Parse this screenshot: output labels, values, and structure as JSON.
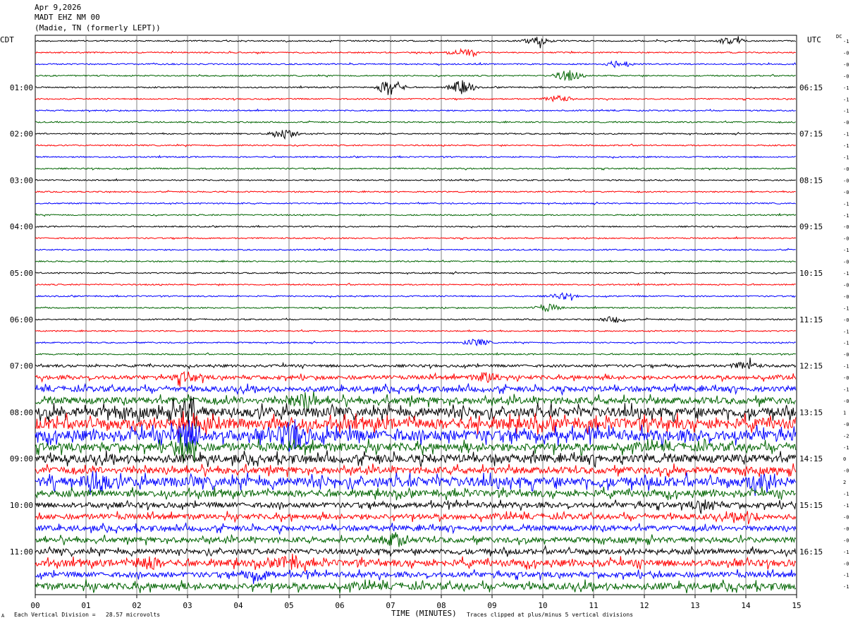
{
  "header": {
    "date": "Apr 9,2026",
    "station": "MADT EHZ NM 00",
    "location": "(Madie, TN (formerly LEPT))"
  },
  "corner_labels": {
    "left": "CDT",
    "right": "UTC",
    "dc": "DC"
  },
  "footer": {
    "scale": "Each Vertical Division =   28.57 microvolts",
    "xlabel": "TIME (MINUTES)",
    "clip_note": "Traces clipped at plus/minus 5 vertical divisions",
    "mark": "A"
  },
  "colors": {
    "black": "#000000",
    "red": "#ff0000",
    "blue": "#0000ff",
    "green": "#006400",
    "grid": "#808080"
  },
  "chart_data": {
    "type": "line",
    "title": "MADT EHZ NM 00",
    "xlabel": "TIME (MINUTES)",
    "xlim": [
      0,
      15
    ],
    "x_ticks": [
      "00",
      "01",
      "02",
      "03",
      "04",
      "05",
      "06",
      "07",
      "08",
      "09",
      "10",
      "11",
      "12",
      "13",
      "14",
      "15"
    ],
    "trace_minutes": 15,
    "left_time_labels": [
      "01:00",
      "02:00",
      "03:00",
      "04:00",
      "05:00",
      "06:00",
      "07:00",
      "08:00",
      "09:00",
      "10:00",
      "11:00"
    ],
    "right_time_labels": [
      "06:15",
      "07:15",
      "08:15",
      "09:15",
      "10:15",
      "11:15",
      "12:15",
      "13:15",
      "14:15",
      "15:15",
      "16:15"
    ],
    "dc_offsets": [
      "-1",
      "-0",
      "-0",
      "-0",
      "-1",
      "-1",
      "-1",
      "-0",
      "-1",
      "-1",
      "-1",
      "-0",
      "-0",
      "-0",
      "-1",
      "-1",
      "-0",
      "-0",
      "-1",
      "-0",
      "-1",
      "-0",
      "-0",
      "-1",
      "-0",
      "-1",
      "-1",
      "-0",
      "-1",
      "-0",
      "-1",
      "-0",
      "1",
      "-0",
      "-2",
      "-1",
      "0",
      "-0",
      "2",
      "-1",
      "-1",
      "-0",
      "-0",
      "-0",
      "-1",
      "-0",
      "-1",
      "-1"
    ],
    "trace_colors": [
      "black",
      "red",
      "blue",
      "green"
    ],
    "amplitude_per_trace": [
      1,
      1,
      1,
      1,
      1,
      1,
      1,
      1,
      1,
      1,
      1,
      1,
      1,
      1,
      1,
      1,
      1,
      1,
      1,
      1,
      1,
      1,
      1,
      1,
      1,
      1,
      1,
      1,
      2,
      3,
      4,
      5,
      7,
      8,
      8,
      6,
      6,
      5,
      7,
      5,
      4,
      4,
      4,
      4,
      4,
      5,
      4,
      5
    ],
    "events": [
      {
        "trace": 0,
        "minute": 9.9,
        "amp": 6
      },
      {
        "trace": 0,
        "minute": 13.7,
        "amp": 5
      },
      {
        "trace": 1,
        "minute": 8.4,
        "amp": 6
      },
      {
        "trace": 2,
        "minute": 11.5,
        "amp": 5
      },
      {
        "trace": 3,
        "minute": 10.5,
        "amp": 8
      },
      {
        "trace": 4,
        "minute": 7.0,
        "amp": 12
      },
      {
        "trace": 4,
        "minute": 8.4,
        "amp": 10
      },
      {
        "trace": 5,
        "minute": 10.3,
        "amp": 5
      },
      {
        "trace": 8,
        "minute": 4.9,
        "amp": 8
      },
      {
        "trace": 22,
        "minute": 10.4,
        "amp": 4
      },
      {
        "trace": 23,
        "minute": 10.1,
        "amp": 5
      },
      {
        "trace": 24,
        "minute": 11.4,
        "amp": 4
      },
      {
        "trace": 26,
        "minute": 8.7,
        "amp": 5
      },
      {
        "trace": 28,
        "minute": 14.0,
        "amp": 5
      },
      {
        "trace": 29,
        "minute": 3.0,
        "amp": 6
      },
      {
        "trace": 29,
        "minute": 8.9,
        "amp": 6
      },
      {
        "trace": 31,
        "minute": 5.3,
        "amp": 9
      },
      {
        "trace": 32,
        "minute": 3.0,
        "amp": 12
      },
      {
        "trace": 33,
        "minute": 3.0,
        "amp": 14
      },
      {
        "trace": 34,
        "minute": 3.0,
        "amp": 16
      },
      {
        "trace": 34,
        "minute": 5.1,
        "amp": 18
      },
      {
        "trace": 35,
        "minute": 3.0,
        "amp": 10
      },
      {
        "trace": 38,
        "minute": 1.2,
        "amp": 12
      },
      {
        "trace": 38,
        "minute": 14.3,
        "amp": 9
      },
      {
        "trace": 40,
        "minute": 13.2,
        "amp": 6
      },
      {
        "trace": 41,
        "minute": 14.0,
        "amp": 5
      },
      {
        "trace": 43,
        "minute": 7.1,
        "amp": 8
      },
      {
        "trace": 45,
        "minute": 2.2,
        "amp": 7
      },
      {
        "trace": 45,
        "minute": 5.0,
        "amp": 8
      },
      {
        "trace": 46,
        "minute": 4.4,
        "amp": 6
      }
    ]
  }
}
